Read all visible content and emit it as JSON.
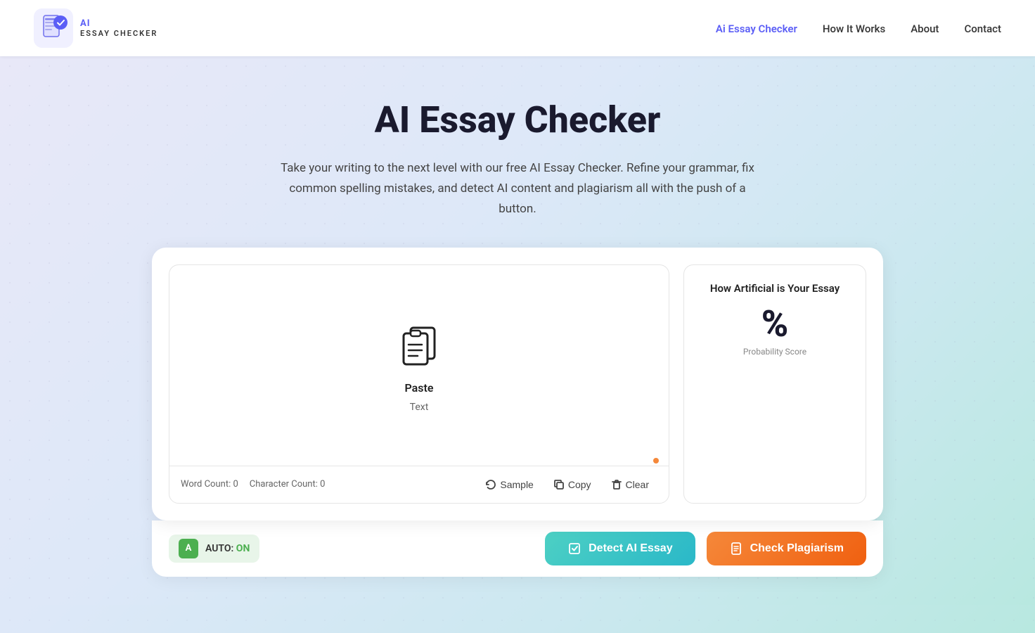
{
  "nav": {
    "logo_ai": "AI",
    "logo_name": "ESSAY",
    "logo_sub": "CHECKER",
    "links": [
      {
        "label": "Ai Essay Checker",
        "active": true
      },
      {
        "label": "How It Works",
        "active": false
      },
      {
        "label": "About",
        "active": false
      },
      {
        "label": "Contact",
        "active": false
      }
    ]
  },
  "hero": {
    "title": "AI Essay Checker",
    "subtitle": "Take your writing to the next level with our free AI Essay Checker. Refine your grammar, fix common spelling mistakes, and detect AI content and plagiarism all with the push of a button."
  },
  "editor": {
    "placeholder_label": "Paste",
    "placeholder_sub": "Text",
    "word_count_label": "Word Count: 0",
    "char_count_label": "Character Count: 0",
    "sample_btn": "Sample",
    "copy_btn": "Copy",
    "clear_btn": "Clear"
  },
  "score": {
    "title": "How Artificial is Your Essay",
    "value": "%",
    "label": "Probability Score"
  },
  "bottom": {
    "auto_label": "AUTO:",
    "auto_status": "ON",
    "detect_btn": "Detect AI Essay",
    "plagiarism_btn": "Check Plagiarism"
  }
}
